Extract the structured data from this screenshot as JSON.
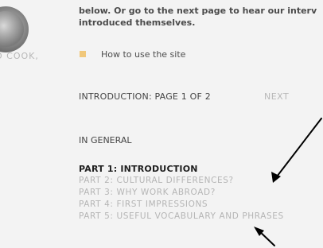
{
  "intro_text": {
    "line1": "below. Or go to the next page to hear our interv",
    "line2": "introduced themselves."
  },
  "side_panel": {
    "name_fragment": "O COOK,"
  },
  "help": {
    "link": "How to use the site",
    "bullet_color": "#f0c77a"
  },
  "pager": {
    "title": "INTRODUCTION: PAGE 1 OF 2",
    "next_label": "NEXT"
  },
  "section": {
    "heading": "IN GENERAL"
  },
  "parts": [
    {
      "label": "PART 1: INTRODUCTION",
      "current": true
    },
    {
      "label": "PART 2: CULTURAL DIFFERENCES?",
      "current": false
    },
    {
      "label": "PART 3: WHY WORK ABROAD?",
      "current": false
    },
    {
      "label": "PART 4: FIRST IMPRESSIONS",
      "current": false
    },
    {
      "label": "PART 5: USEFUL VOCABULARY AND PHRASES",
      "current": false
    }
  ],
  "colors": {
    "background": "#f3f3f3",
    "text_dark": "#444444",
    "text_muted": "#b5b5b5",
    "accent_bullet": "#f0c77a",
    "arrow": "#000000"
  },
  "icons": {
    "help_bullet": "square-bullet-icon",
    "annotation_arrow": "arrow-icon"
  }
}
